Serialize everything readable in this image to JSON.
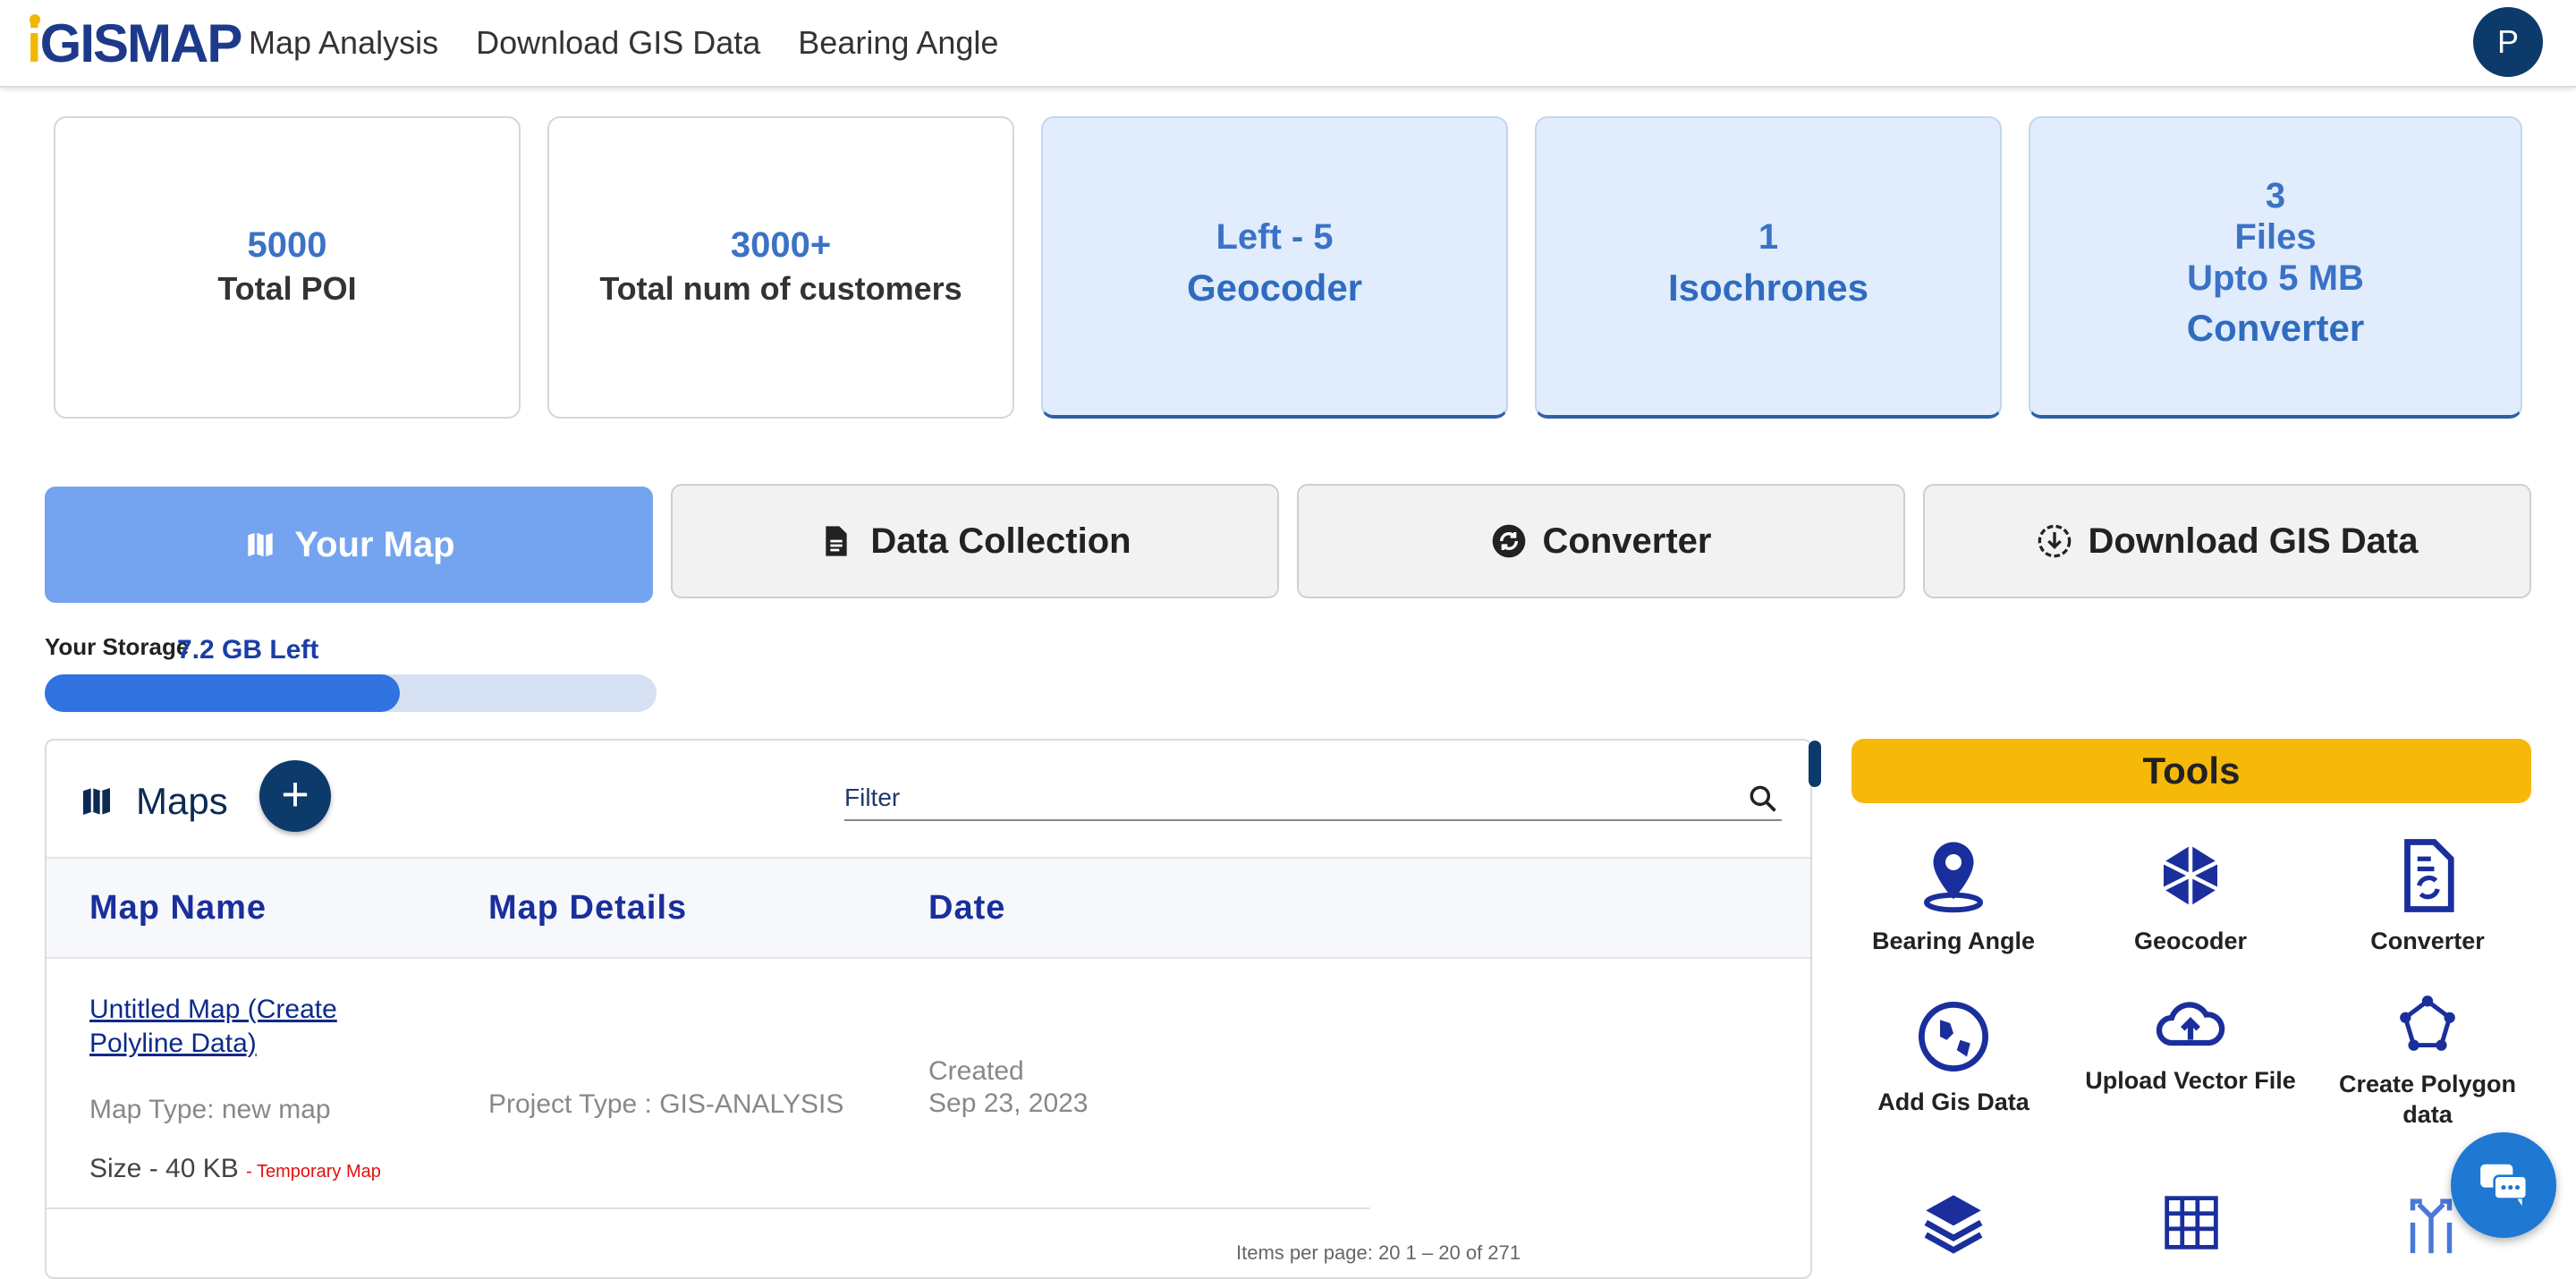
{
  "header": {
    "logo": "GISMAP",
    "nav": [
      "Map Analysis",
      "Download GIS Data",
      "Bearing Angle"
    ],
    "avatar_initial": "P"
  },
  "cards": [
    {
      "value": "5000",
      "label": "Total POI"
    },
    {
      "value": "3000+",
      "label": "Total num of customers"
    },
    {
      "value": "Left - 5",
      "label": "Geocoder"
    },
    {
      "value": "1",
      "label": "Isochrones"
    },
    {
      "line1": "3",
      "line2": "Files",
      "line3": "Upto 5 MB",
      "label": "Converter"
    }
  ],
  "tabs": [
    "Your Map",
    "Data Collection",
    "Converter",
    "Download GIS Data"
  ],
  "storage": {
    "label": "Your Storage",
    "value": "7.2 GB Left",
    "used_fraction": 0.58
  },
  "maps": {
    "title": "Maps",
    "add_label": "+",
    "filter_placeholder": "Filter",
    "columns": [
      "Map Name",
      "Map Details",
      "Date"
    ],
    "row": {
      "name": "Untitled Map (Create Polyline Data)",
      "type": "Map Type: new map",
      "size": "Size - 40 KB",
      "temp": "- Temporary Map",
      "project": "Project Type : GIS-ANALYSIS",
      "created_label": "Created",
      "created_date": "Sep 23, 2023"
    },
    "pager": "Items per page: 20     1 – 20 of 271"
  },
  "tools": {
    "title": "Tools",
    "items": [
      "Bearing Angle",
      "Geocoder",
      "Converter",
      "Add Gis Data",
      "Upload Vector File",
      "Create Polygon data"
    ]
  },
  "colors": {
    "brand_dark": "#0b3a6b",
    "accent_blue": "#2f72e0",
    "tools_yellow": "#f6b90a",
    "link": "#1a2f9c"
  }
}
